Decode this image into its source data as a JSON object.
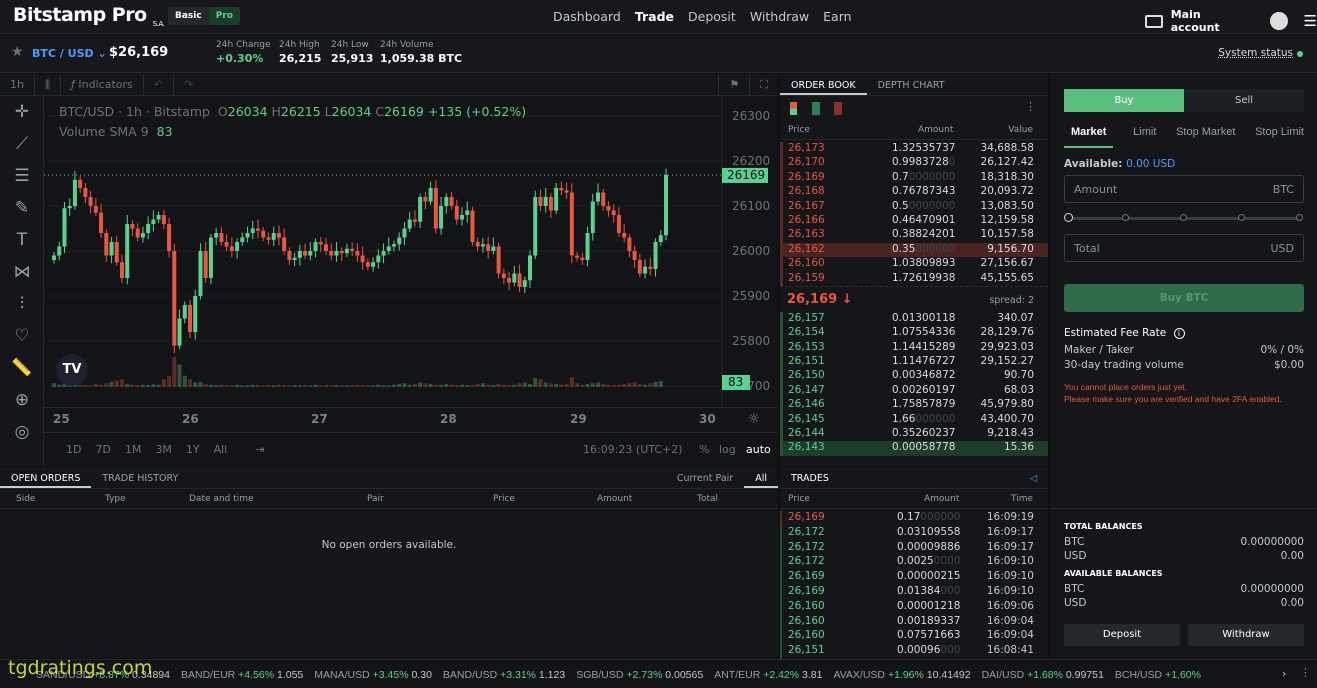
{
  "header": {
    "logo": "Bitstamp Pro",
    "logo_suffix": "S.A.",
    "mode_basic": "Basic",
    "mode_pro": "Pro",
    "nav": [
      "Dashboard",
      "Trade",
      "Deposit",
      "Withdraw",
      "Earn"
    ],
    "account": "Main account"
  },
  "ticker": {
    "pair": "BTC / USD",
    "price": "$26,169",
    "stats": [
      {
        "label": "24h Change",
        "value": "+0.30%"
      },
      {
        "label": "24h High",
        "value": "26,215"
      },
      {
        "label": "24h Low",
        "value": "25,913"
      },
      {
        "label": "24h Volume",
        "value": "1,059.38 BTC"
      }
    ],
    "system_status": "System status",
    "status_color": "#5bd190"
  },
  "chart": {
    "toolbar": {
      "interval": "1h",
      "indicators": "Indicators"
    },
    "legend": {
      "symbol": "BTC/USD · 1h · Bitstamp",
      "o": "26034",
      "h": "26215",
      "l": "26034",
      "c": "26169",
      "change": "+135 (+0.52%)",
      "volume_label": "Volume SMA 9",
      "volume_value": "83"
    },
    "price_ticks": [
      "26300",
      "26200",
      "26100",
      "26000",
      "25900",
      "25800",
      "25700"
    ],
    "last_price": "26169",
    "last_volume": "83",
    "x_ticks": [
      "25",
      "26",
      "27",
      "28",
      "29",
      "30"
    ],
    "ranges": [
      "1D",
      "7D",
      "1M",
      "3M",
      "1Y",
      "All"
    ],
    "clock": "16:09:23 (UTC+2)",
    "scale_opts": [
      "%",
      "log",
      "auto"
    ],
    "up_color": "#5bd190",
    "down_color": "#e9573f",
    "closes": [
      25990,
      26010,
      26095,
      26100,
      26158,
      26140,
      26120,
      26100,
      26085,
      26040,
      25990,
      26020,
      25975,
      25940,
      26060,
      26050,
      26030,
      26040,
      26060,
      26070,
      26080,
      26060,
      26000,
      25790,
      25850,
      25880,
      25820,
      25900,
      26000,
      25940,
      26030,
      26040,
      26020,
      26010,
      26000,
      26020,
      26030,
      26040,
      26050,
      26045,
      26030,
      26025,
      26040,
      26030,
      26000,
      25980,
      25985,
      26000,
      25990,
      26000,
      26020,
      26015,
      26000,
      25990,
      26000,
      25995,
      26005,
      26000,
      25990,
      25975,
      25965,
      25975,
      25990,
      26000,
      26010,
      26015,
      26030,
      26050,
      26070,
      26065,
      26120,
      26110,
      26140,
      26050,
      26100,
      26120,
      26100,
      26070,
      26080,
      26090,
      26020,
      26010,
      26015,
      26000,
      26010,
      25950,
      25940,
      25930,
      25950,
      25920,
      25935,
      25990,
      26120,
      26100,
      26120,
      26090,
      26140,
      26135,
      26130,
      25990,
      25985,
      25980,
      26040,
      26110,
      26130,
      26100,
      26090,
      26080,
      26040,
      26030,
      26000,
      25980,
      25950,
      25965,
      25960,
      26020,
      26035,
      26169
    ],
    "volumes": [
      10,
      6,
      8,
      5,
      12,
      6,
      5,
      4,
      8,
      6,
      10,
      14,
      18,
      20,
      8,
      6,
      5,
      6,
      5,
      7,
      6,
      20,
      30,
      80,
      60,
      30,
      20,
      12,
      14,
      8,
      6,
      5,
      6,
      4,
      5,
      6,
      4,
      5,
      6,
      5,
      4,
      5,
      4,
      6,
      5,
      4,
      5,
      4,
      5,
      4,
      6,
      4,
      5,
      4,
      5,
      4,
      4,
      5,
      6,
      4,
      5,
      4,
      6,
      5,
      4,
      6,
      8,
      10,
      6,
      8,
      12,
      10,
      8,
      6,
      6,
      8,
      6,
      5,
      6,
      5,
      6,
      8,
      10,
      6,
      5,
      8,
      6,
      5,
      6,
      10,
      12,
      8,
      24,
      20,
      12,
      10,
      8,
      6,
      8,
      26,
      10,
      6,
      8,
      10,
      12,
      8,
      6,
      5,
      6,
      8,
      10,
      12,
      8,
      6,
      10,
      14,
      16
    ]
  },
  "open_orders": {
    "tabs": [
      "OPEN ORDERS",
      "TRADE HISTORY"
    ],
    "filters": [
      "Current Pair",
      "All"
    ],
    "columns": [
      "Side",
      "Type",
      "Date and time",
      "Pair",
      "Price",
      "Amount",
      "Total"
    ],
    "empty": "No open orders available."
  },
  "order_book": {
    "tabs": [
      "ORDER BOOK",
      "DEPTH CHART"
    ],
    "columns": [
      "Price",
      "Amount",
      "Value"
    ],
    "asks": [
      [
        "26,173",
        "1.32535737",
        "",
        "34,688.58"
      ],
      [
        "26,170",
        "0.9983728",
        "0",
        "26,127.42"
      ],
      [
        "26,169",
        "0.7",
        "0000000",
        "18,318.30"
      ],
      [
        "26,168",
        "0.76787343",
        "",
        "20,093.72"
      ],
      [
        "26,167",
        "0.5",
        "0000000",
        "13,083.50"
      ],
      [
        "26,166",
        "0.46470901",
        "",
        "12,159.58"
      ],
      [
        "26,163",
        "0.38824201",
        "",
        "10,157.58"
      ],
      [
        "26,162",
        "0.35",
        "000000",
        "9,156.70"
      ],
      [
        "26,160",
        "1.03809893",
        "",
        "27,156.67"
      ],
      [
        "26,159",
        "1.72619938",
        "",
        "45,155.65"
      ]
    ],
    "mid_price": "26,169",
    "spread": "spread: 2",
    "bids": [
      [
        "26,157",
        "0.01300118",
        "",
        "340.07"
      ],
      [
        "26,154",
        "1.07554336",
        "",
        "28,129.76"
      ],
      [
        "26,153",
        "1.14415289",
        "",
        "29,923.03"
      ],
      [
        "26,151",
        "1.11476727",
        "",
        "29,152.27"
      ],
      [
        "26,150",
        "0.00346872",
        "",
        "90.70"
      ],
      [
        "26,147",
        "0.00260197",
        "",
        "68.03"
      ],
      [
        "26,146",
        "1.75857879",
        "",
        "45,979.80"
      ],
      [
        "26,145",
        "1.66",
        "000000",
        "43,400.70"
      ],
      [
        "26,144",
        "0.35260237",
        "",
        "9,218.43"
      ],
      [
        "26,143",
        "0.00058778",
        "",
        "15.36"
      ]
    ]
  },
  "trades": {
    "title": "TRADES",
    "columns": [
      "Price",
      "Amount",
      "Time"
    ],
    "rows": [
      [
        "26,169",
        "0.17",
        "000000",
        "16:09:19",
        "sell"
      ],
      [
        "26,172",
        "0.03109558",
        "",
        "16:09:17",
        "buy"
      ],
      [
        "26,172",
        "0.00009886",
        "",
        "16:09:17",
        "buy"
      ],
      [
        "26,172",
        "0.0025",
        "0000",
        "16:09:10",
        "buy"
      ],
      [
        "26,169",
        "0.00000215",
        "",
        "16:09:10",
        "buy"
      ],
      [
        "26,169",
        "0.01384",
        "000",
        "16:09:10",
        "buy"
      ],
      [
        "26,160",
        "0.00001218",
        "",
        "16:09:06",
        "buy"
      ],
      [
        "26,160",
        "0.00189337",
        "",
        "16:09:04",
        "buy"
      ],
      [
        "26,160",
        "0.07571663",
        "",
        "16:09:04",
        "buy"
      ],
      [
        "26,151",
        "0.00096",
        "000",
        "16:08:41",
        "buy"
      ]
    ]
  },
  "order_form": {
    "buy": "Buy",
    "sell": "Sell",
    "types": [
      "Market",
      "Limit",
      "Stop Market",
      "Stop Limit"
    ],
    "available_label": "Available:",
    "available_value": "0.00 USD",
    "amount_placeholder": "Amount",
    "amount_unit": "BTC",
    "total_placeholder": "Total",
    "total_unit": "USD",
    "slider_value": 0,
    "submit": "Buy BTC",
    "fee_title": "Estimated Fee Rate",
    "maker_taker_label": "Maker / Taker",
    "maker_taker_value": "0% / 0%",
    "volume_label": "30-day trading volume",
    "volume_value": "$0.00",
    "warning_1": "You cannot place orders just yet.",
    "warning_2": "Please make sure you are verified and have 2FA enabled."
  },
  "balances": {
    "total_title": "TOTAL BALANCES",
    "available_title": "AVAILABLE BALANCES",
    "total": [
      [
        "BTC",
        "0.00000000"
      ],
      [
        "USD",
        "0.00"
      ]
    ],
    "available": [
      [
        "BTC",
        "0.00000000"
      ],
      [
        "USD",
        "0.00"
      ]
    ],
    "deposit": "Deposit",
    "withdraw": "Withdraw"
  },
  "market_ticker": [
    [
      "SAND/USD",
      "+8.87%",
      "0.34894"
    ],
    [
      "BAND/EUR",
      "+4.56%",
      "1.055"
    ],
    [
      "MANA/USD",
      "+3.45%",
      "0.30"
    ],
    [
      "BAND/USD",
      "+3.31%",
      "1.123"
    ],
    [
      "SGB/USD",
      "+2.73%",
      "0.00565"
    ],
    [
      "ANT/EUR",
      "+2.42%",
      "3.81"
    ],
    [
      "AVAX/USD",
      "+1.96%",
      "10.41492"
    ],
    [
      "DAI/USD",
      "+1.68%",
      "0.99751"
    ],
    [
      "BCH/USD",
      "+1.60%",
      ""
    ]
  ],
  "watermark": "tgdratings.com"
}
